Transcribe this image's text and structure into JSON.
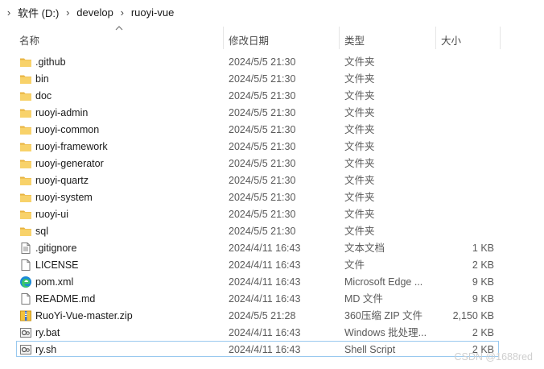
{
  "breadcrumb": [
    {
      "label": "软件 (D:)"
    },
    {
      "label": "develop"
    },
    {
      "label": "ruoyi-vue"
    }
  ],
  "columns": {
    "name": "名称",
    "date": "修改日期",
    "type": "类型",
    "size": "大小"
  },
  "sort": {
    "column": "name",
    "direction": "ascending",
    "icon": "chevron-up-icon"
  },
  "files": [
    {
      "name": ".github",
      "date": "2024/5/5 21:30",
      "type": "文件夹",
      "size": "",
      "icon": "folder-icon"
    },
    {
      "name": "bin",
      "date": "2024/5/5 21:30",
      "type": "文件夹",
      "size": "",
      "icon": "folder-icon"
    },
    {
      "name": "doc",
      "date": "2024/5/5 21:30",
      "type": "文件夹",
      "size": "",
      "icon": "folder-icon"
    },
    {
      "name": "ruoyi-admin",
      "date": "2024/5/5 21:30",
      "type": "文件夹",
      "size": "",
      "icon": "folder-icon"
    },
    {
      "name": "ruoyi-common",
      "date": "2024/5/5 21:30",
      "type": "文件夹",
      "size": "",
      "icon": "folder-icon"
    },
    {
      "name": "ruoyi-framework",
      "date": "2024/5/5 21:30",
      "type": "文件夹",
      "size": "",
      "icon": "folder-icon"
    },
    {
      "name": "ruoyi-generator",
      "date": "2024/5/5 21:30",
      "type": "文件夹",
      "size": "",
      "icon": "folder-icon"
    },
    {
      "name": "ruoyi-quartz",
      "date": "2024/5/5 21:30",
      "type": "文件夹",
      "size": "",
      "icon": "folder-icon"
    },
    {
      "name": "ruoyi-system",
      "date": "2024/5/5 21:30",
      "type": "文件夹",
      "size": "",
      "icon": "folder-icon"
    },
    {
      "name": "ruoyi-ui",
      "date": "2024/5/5 21:30",
      "type": "文件夹",
      "size": "",
      "icon": "folder-icon"
    },
    {
      "name": "sql",
      "date": "2024/5/5 21:30",
      "type": "文件夹",
      "size": "",
      "icon": "folder-icon"
    },
    {
      "name": ".gitignore",
      "date": "2024/4/11 16:43",
      "type": "文本文档",
      "size": "1 KB",
      "icon": "text-file-icon"
    },
    {
      "name": "LICENSE",
      "date": "2024/4/11 16:43",
      "type": "文件",
      "size": "2 KB",
      "icon": "blank-file-icon"
    },
    {
      "name": "pom.xml",
      "date": "2024/4/11 16:43",
      "type": "Microsoft Edge ...",
      "size": "9 KB",
      "icon": "edge-icon"
    },
    {
      "name": "README.md",
      "date": "2024/4/11 16:43",
      "type": "MD 文件",
      "size": "9 KB",
      "icon": "blank-file-icon"
    },
    {
      "name": "RuoYi-Vue-master.zip",
      "date": "2024/5/5 21:28",
      "type": "360压缩 ZIP 文件",
      "size": "2,150 KB",
      "icon": "zip-archive-icon"
    },
    {
      "name": "ry.bat",
      "date": "2024/4/11 16:43",
      "type": "Windows 批处理...",
      "size": "2 KB",
      "icon": "batch-file-icon"
    },
    {
      "name": "ry.sh",
      "date": "2024/4/11 16:43",
      "type": "Shell Script",
      "size": "2 KB",
      "icon": "script-file-icon",
      "selected": true
    }
  ],
  "watermark": "CSDN @1688red"
}
